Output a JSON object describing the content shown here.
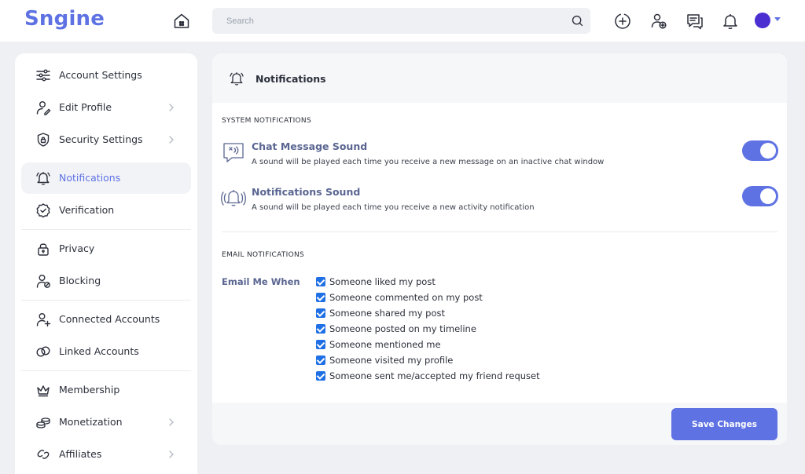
{
  "header": {
    "logo": "Sngine",
    "search_placeholder": "Search"
  },
  "sidebar": {
    "items": [
      {
        "label": "Account Settings",
        "icon": "sliders-icon"
      },
      {
        "label": "Edit Profile",
        "icon": "user-edit-icon"
      },
      {
        "label": "Security Settings",
        "icon": "shield-lock-icon"
      },
      {
        "label": "Notifications",
        "icon": "bell-icon",
        "active": true
      },
      {
        "label": "Verification",
        "icon": "verified-badge-icon"
      },
      {
        "label": "Privacy",
        "icon": "padlock-icon"
      },
      {
        "label": "Blocking",
        "icon": "user-block-icon"
      },
      {
        "label": "Connected Accounts",
        "icon": "user-plus-icon"
      },
      {
        "label": "Linked Accounts",
        "icon": "link-rings-icon"
      },
      {
        "label": "Membership",
        "icon": "crown-icon"
      },
      {
        "label": "Monetization",
        "icon": "coins-icon"
      },
      {
        "label": "Affiliates",
        "icon": "link-icon"
      }
    ]
  },
  "main": {
    "title": "Notifications",
    "system_label": "SYSTEM NOTIFICATIONS",
    "settings": [
      {
        "title": "Chat Message Sound",
        "desc": "A sound will be played each time you receive a new message on an inactive chat window",
        "enabled": true
      },
      {
        "title": "Notifications Sound",
        "desc": "A sound will be played each time you receive a new activity notification",
        "enabled": true
      }
    ],
    "email_label": "EMAIL NOTIFICATIONS",
    "email_when": "Email Me When",
    "checkboxes": [
      "Someone liked my post",
      "Someone commented on my post",
      "Someone shared my post",
      "Someone posted on my timeline",
      "Someone mentioned me",
      "Someone visited my profile",
      "Someone sent me/accepted my friend requset"
    ],
    "save_label": "Save Changes"
  },
  "colors": {
    "accent": "#5e72e4",
    "checkbox": "#1f6fe5",
    "background": "#eef0f4"
  }
}
